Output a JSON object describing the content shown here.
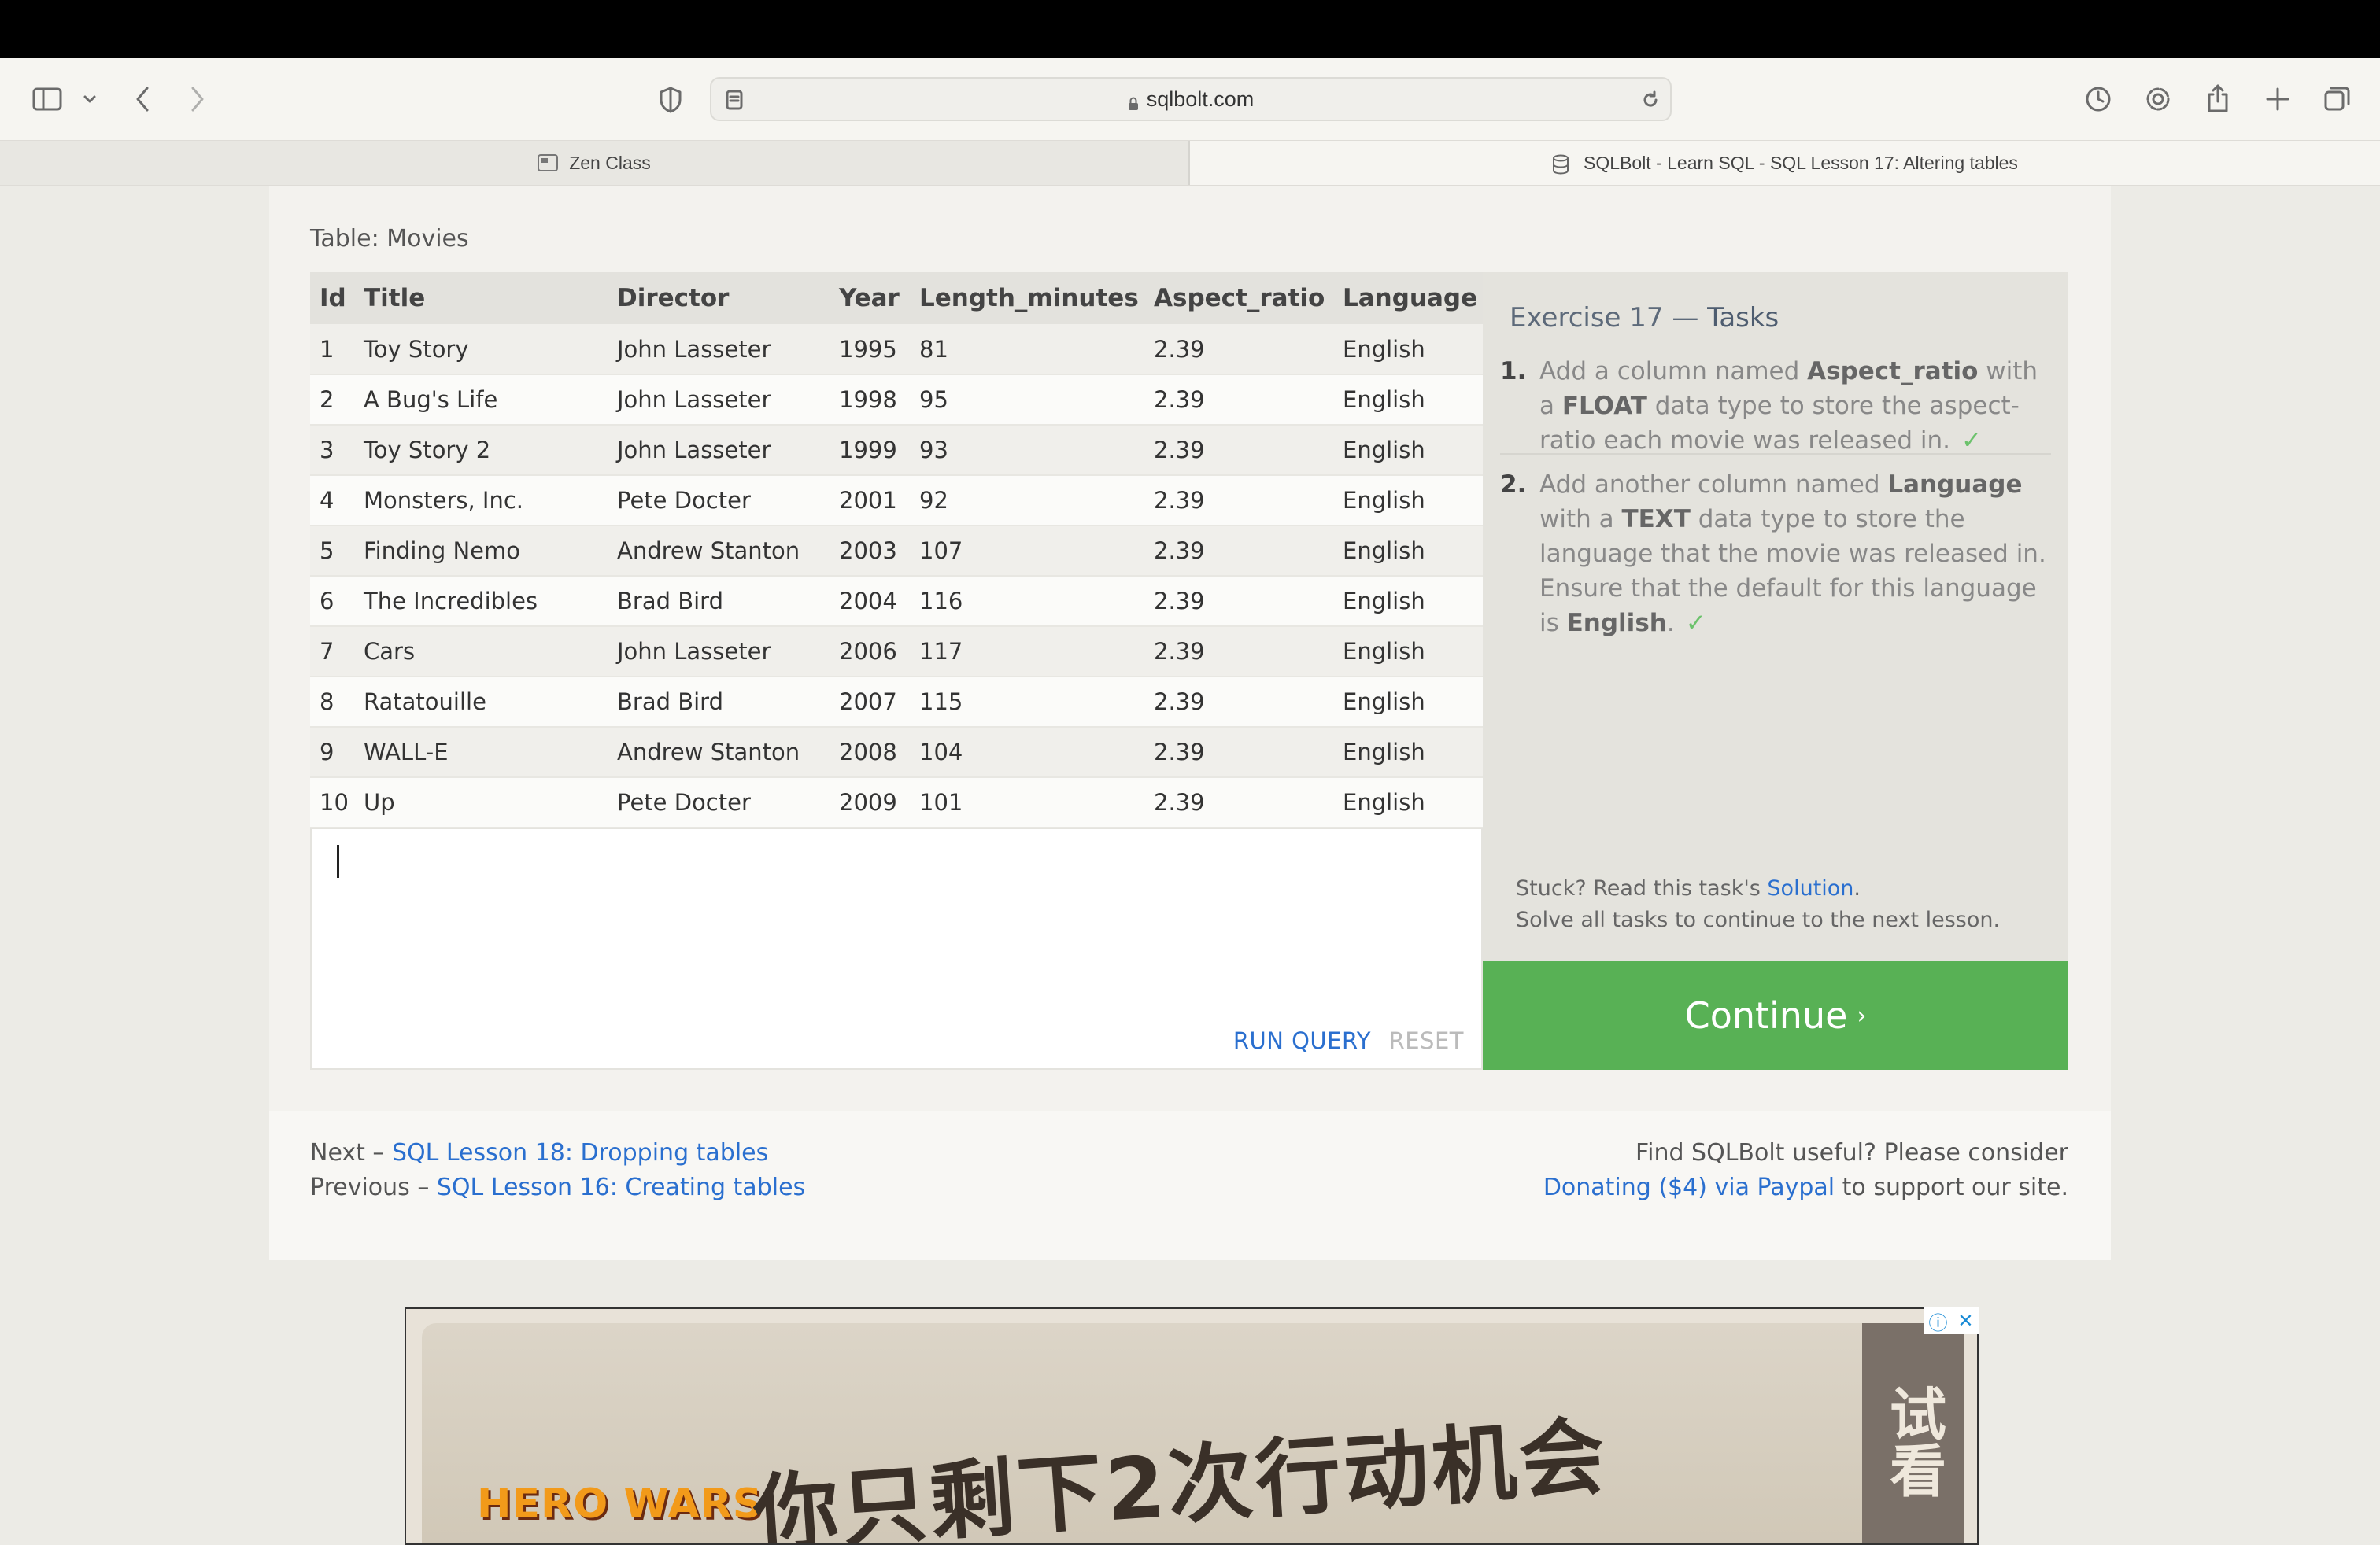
{
  "browser": {
    "url": "sqlbolt.com",
    "tabs": [
      {
        "label": "Zen Class",
        "active": false
      },
      {
        "label": "SQLBolt - Learn SQL - SQL Lesson 17: Altering tables",
        "active": true
      }
    ]
  },
  "table": {
    "title": "Table: Movies",
    "columns": [
      "Id",
      "Title",
      "Director",
      "Year",
      "Length_minutes",
      "Aspect_ratio",
      "Language"
    ],
    "rows": [
      [
        "1",
        "Toy Story",
        "John Lasseter",
        "1995",
        "81",
        "2.39",
        "English"
      ],
      [
        "2",
        "A Bug's Life",
        "John Lasseter",
        "1998",
        "95",
        "2.39",
        "English"
      ],
      [
        "3",
        "Toy Story 2",
        "John Lasseter",
        "1999",
        "93",
        "2.39",
        "English"
      ],
      [
        "4",
        "Monsters, Inc.",
        "Pete Docter",
        "2001",
        "92",
        "2.39",
        "English"
      ],
      [
        "5",
        "Finding Nemo",
        "Andrew Stanton",
        "2003",
        "107",
        "2.39",
        "English"
      ],
      [
        "6",
        "The Incredibles",
        "Brad Bird",
        "2004",
        "116",
        "2.39",
        "English"
      ],
      [
        "7",
        "Cars",
        "John Lasseter",
        "2006",
        "117",
        "2.39",
        "English"
      ],
      [
        "8",
        "Ratatouille",
        "Brad Bird",
        "2007",
        "115",
        "2.39",
        "English"
      ],
      [
        "9",
        "WALL-E",
        "Andrew Stanton",
        "2008",
        "104",
        "2.39",
        "English"
      ],
      [
        "10",
        "Up",
        "Pete Docter",
        "2009",
        "101",
        "2.39",
        "English"
      ]
    ]
  },
  "editor": {
    "run_label": "RUN QUERY",
    "reset_label": "RESET"
  },
  "exercise": {
    "title_prefix": "Exercise 17 — ",
    "title_main": "Tasks",
    "tasks": [
      {
        "num": "1.",
        "parts": [
          "Add a column named ",
          "Aspect_ratio",
          " with a ",
          "FLOAT",
          " data type to store the aspect-ratio each movie was released in."
        ],
        "tick": "✓"
      },
      {
        "num": "2.",
        "parts": [
          "Add another column named ",
          "Language",
          " with a ",
          "TEXT",
          " data type to store the language that the movie was released in. Ensure that the default for this language is ",
          "English",
          "."
        ],
        "tick": "✓"
      }
    ],
    "stuck_prefix": "Stuck? Read this task's ",
    "solution_link": "Solution",
    "stuck_suffix": ".",
    "solve_all": "Solve all tasks to continue to the next lesson.",
    "continue_label": "Continue",
    "continue_chevron": "›"
  },
  "footer_nav": {
    "next_prefix": "Next – ",
    "next_link": "SQL Lesson 18: Dropping tables",
    "prev_prefix": "Previous – ",
    "prev_link": "SQL Lesson 16: Creating tables",
    "donate_line1": "Find SQLBolt useful? Please consider",
    "donate_link": "Donating ($4) via Paypal",
    "donate_suffix": " to support our site."
  },
  "ad": {
    "logo": "HERO WARS",
    "headline": "你只剩下2次行动机会",
    "side": "试看",
    "info_icon": "ⓘ",
    "close_icon": "✕"
  },
  "colors": {
    "link": "#2a6fcf",
    "continue": "#58b155",
    "tick": "#6cc26c"
  }
}
